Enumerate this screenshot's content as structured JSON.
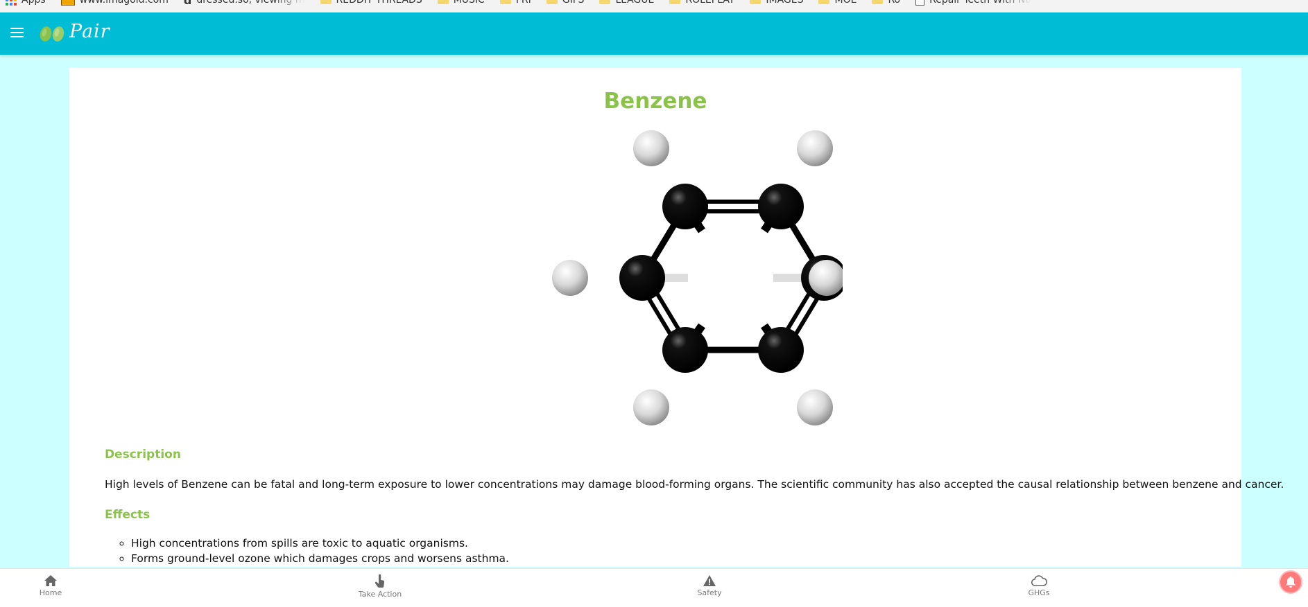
{
  "bookmarks": [
    {
      "label": "Apps",
      "icon": "apps-grid-icon"
    },
    {
      "label": "www.imagoid.com",
      "icon": "imagoid-icon"
    },
    {
      "label": "dressed.so, viewing m",
      "icon": "d-logo-icon"
    },
    {
      "label": "REDDIT THREADS",
      "icon": "folder-icon"
    },
    {
      "label": "MUSIC",
      "icon": "folder-icon"
    },
    {
      "label": "FRI",
      "icon": "folder-icon"
    },
    {
      "label": "GIFS",
      "icon": "folder-icon"
    },
    {
      "label": "LEAGUE",
      "icon": "folder-icon"
    },
    {
      "label": "ROLEPLAY",
      "icon": "folder-icon"
    },
    {
      "label": "IMAGES",
      "icon": "folder-icon"
    },
    {
      "label": "MOE",
      "icon": "folder-icon"
    },
    {
      "label": "Ro",
      "icon": "folder-icon"
    },
    {
      "label": "Repair Teeth With No",
      "icon": "document-icon"
    }
  ],
  "header": {
    "app_name": "Pair",
    "menu_icon": "hamburger-menu-icon",
    "color": "#00bcd4"
  },
  "page": {
    "title": "Benzene",
    "accent_color": "#8bc34a",
    "molecule_image": "benzene-ball-and-stick-model",
    "description_heading": "Description",
    "description_text": "High levels of Benzene can be fatal and long-term exposure to lower concentrations may damage blood-forming organs. The scientific community has also accepted the causal relationship between benzene and cancer.",
    "effects_heading": "Effects",
    "effects": [
      "High concentrations from spills are toxic to aquatic organisms.",
      "Forms ground-level ozone which damages crops and worsens asthma."
    ]
  },
  "bottom_nav": [
    {
      "label": "Home",
      "icon": "home-icon"
    },
    {
      "label": "Take Action",
      "icon": "hand-pointer-icon"
    },
    {
      "label": "Safety",
      "icon": "warning-icon"
    },
    {
      "label": "GHGs",
      "icon": "cloud-icon"
    }
  ],
  "notification_icon": "bell-notification-icon"
}
